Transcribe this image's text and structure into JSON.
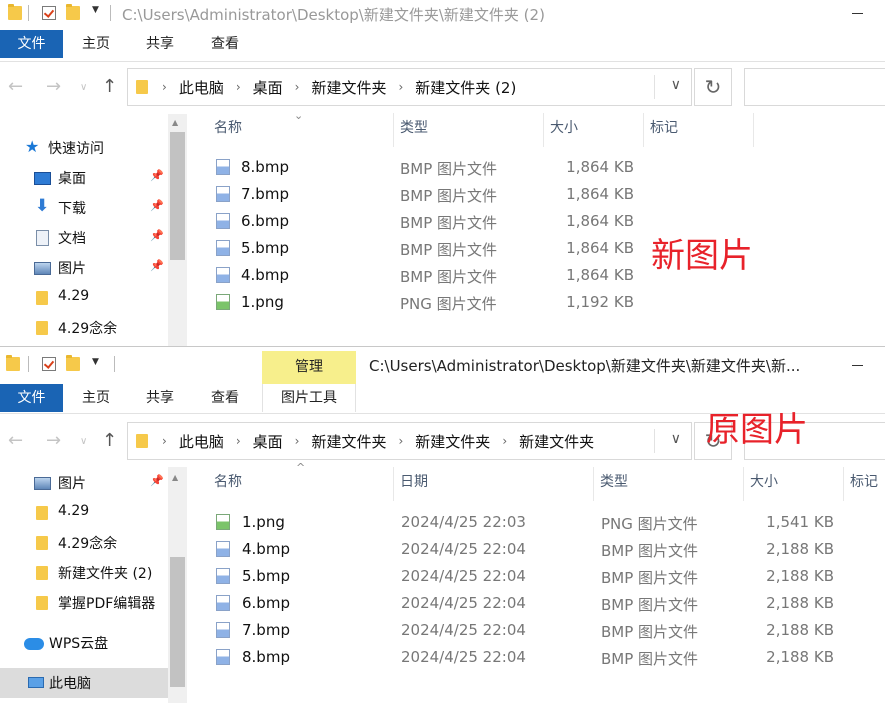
{
  "new_window": {
    "title": "C:\\Users\\Administrator\\Desktop\\新建文件夹\\新建文件夹 (2)",
    "ribbon_tabs": [
      "文件",
      "主页",
      "共享",
      "查看"
    ],
    "breadcrumb": [
      "此电脑",
      "桌面",
      "新建文件夹",
      "新建文件夹 (2)"
    ],
    "sidebar": [
      {
        "label": "快速访问",
        "icon": "star-icon",
        "pinned": false
      },
      {
        "label": "桌面",
        "icon": "desktop-icon",
        "pinned": true
      },
      {
        "label": "下载",
        "icon": "download-icon",
        "pinned": true
      },
      {
        "label": "文档",
        "icon": "document-icon",
        "pinned": true
      },
      {
        "label": "图片",
        "icon": "pictures-icon",
        "pinned": true
      },
      {
        "label": "4.29",
        "icon": "folder-icon",
        "pinned": false
      },
      {
        "label": "4.29念余",
        "icon": "folder-icon",
        "pinned": false
      }
    ],
    "columns": [
      "名称",
      "类型",
      "大小",
      "标记"
    ],
    "files": [
      {
        "name": "8.bmp",
        "type": "BMP 图片文件",
        "size": "1,864 KB"
      },
      {
        "name": "7.bmp",
        "type": "BMP 图片文件",
        "size": "1,864 KB"
      },
      {
        "name": "6.bmp",
        "type": "BMP 图片文件",
        "size": "1,864 KB"
      },
      {
        "name": "5.bmp",
        "type": "BMP 图片文件",
        "size": "1,864 KB"
      },
      {
        "name": "4.bmp",
        "type": "BMP 图片文件",
        "size": "1,864 KB"
      },
      {
        "name": "1.png",
        "type": "PNG 图片文件",
        "size": "1,192 KB"
      }
    ],
    "annotation": "新图片"
  },
  "orig_window": {
    "title": "C:\\Users\\Administrator\\Desktop\\新建文件夹\\新建文件夹\\新...",
    "ribbon_tabs": [
      "文件",
      "主页",
      "共享",
      "查看"
    ],
    "context_tab": "管理",
    "context_subtab": "图片工具",
    "breadcrumb": [
      "此电脑",
      "桌面",
      "新建文件夹",
      "新建文件夹",
      "新建文件夹"
    ],
    "sidebar": [
      {
        "label": "图片",
        "icon": "pictures-icon",
        "pinned": true
      },
      {
        "label": "4.29",
        "icon": "folder-icon",
        "pinned": false
      },
      {
        "label": "4.29念余",
        "icon": "folder-icon",
        "pinned": false
      },
      {
        "label": "新建文件夹 (2)",
        "icon": "folder-icon",
        "pinned": false
      },
      {
        "label": "掌握PDF编辑器",
        "icon": "folder-icon",
        "pinned": false
      },
      {
        "label": "WPS云盘",
        "icon": "cloud-icon",
        "pinned": false
      },
      {
        "label": "此电脑",
        "icon": "pc-icon",
        "pinned": false,
        "selected": true
      }
    ],
    "columns": [
      "名称",
      "日期",
      "类型",
      "大小",
      "标记"
    ],
    "files": [
      {
        "name": "1.png",
        "date": "2024/4/25 22:03",
        "type": "PNG 图片文件",
        "size": "1,541 KB"
      },
      {
        "name": "4.bmp",
        "date": "2024/4/25 22:04",
        "type": "BMP 图片文件",
        "size": "2,188 KB"
      },
      {
        "name": "5.bmp",
        "date": "2024/4/25 22:04",
        "type": "BMP 图片文件",
        "size": "2,188 KB"
      },
      {
        "name": "6.bmp",
        "date": "2024/4/25 22:04",
        "type": "BMP 图片文件",
        "size": "2,188 KB"
      },
      {
        "name": "7.bmp",
        "date": "2024/4/25 22:04",
        "type": "BMP 图片文件",
        "size": "2,188 KB"
      },
      {
        "name": "8.bmp",
        "date": "2024/4/25 22:04",
        "type": "BMP 图片文件",
        "size": "2,188 KB"
      }
    ],
    "annotation": "原图片"
  },
  "colors": {
    "file_tab": "#1a64b4",
    "context_tab": "#f7ef8c",
    "annotation": "#e8222a",
    "selected": "#dcdcdc"
  }
}
